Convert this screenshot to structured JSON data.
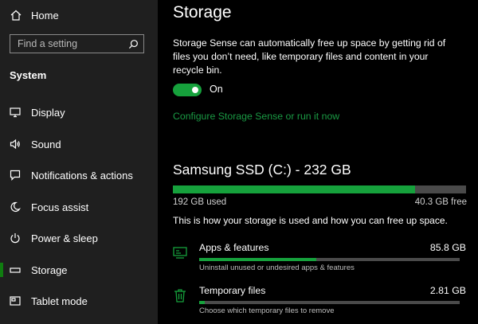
{
  "sidebar": {
    "home_label": "Home",
    "search_placeholder": "Find a setting",
    "section_title": "System",
    "items": [
      {
        "label": "Display",
        "icon": "display-icon"
      },
      {
        "label": "Sound",
        "icon": "speaker-icon"
      },
      {
        "label": "Notifications & actions",
        "icon": "notification-icon"
      },
      {
        "label": "Focus assist",
        "icon": "moon-icon"
      },
      {
        "label": "Power & sleep",
        "icon": "power-icon"
      },
      {
        "label": "Storage",
        "icon": "storage-icon",
        "active": true
      },
      {
        "label": "Tablet mode",
        "icon": "tablet-icon"
      }
    ]
  },
  "main": {
    "title": "Storage",
    "description": "Storage Sense can automatically free up space by getting rid of files you don’t need, like temporary files and content in your recycle bin.",
    "toggle_state": "On",
    "toggle_on": true,
    "link": "Configure Storage Sense or run it now",
    "drive": {
      "title": "Samsung SSD (C:) - 232 GB",
      "used_label": "192 GB used",
      "free_label": "40.3 GB free",
      "used_fraction": 0.826
    },
    "how_text": "This is how your storage is used and how you can free up space.",
    "categories": [
      {
        "name": "Apps & features",
        "size": "85.8 GB",
        "sub": "Uninstall unused or undesired apps & features",
        "fraction": 0.45,
        "icon": "apps-icon"
      },
      {
        "name": "Temporary files",
        "size": "2.81 GB",
        "sub": "Choose which temporary files to remove",
        "fraction": 0.02,
        "icon": "trash-icon"
      }
    ]
  },
  "colors": {
    "accent": "#16a13c",
    "sidebar_bg": "#1f1f1f",
    "main_bg": "#000000",
    "bar_track": "#4a4a4a"
  }
}
